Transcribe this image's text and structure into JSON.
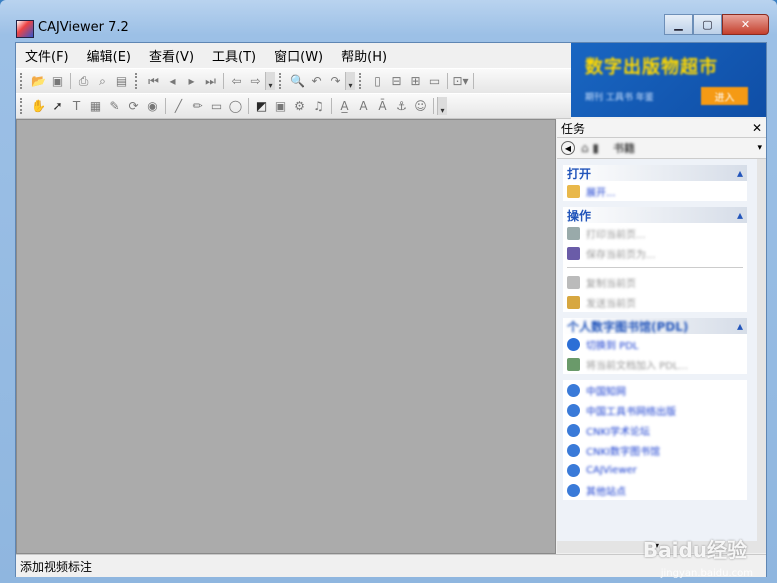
{
  "window": {
    "title": "CAJViewer 7.2",
    "minimize_glyph": "▁",
    "maximize_glyph": "▢",
    "close_glyph": "✕"
  },
  "menu": {
    "items": [
      "文件(F)",
      "编辑(E)",
      "查看(V)",
      "工具(T)",
      "窗口(W)",
      "帮助(H)"
    ]
  },
  "toolbar1": {
    "icons": [
      "open-folder-icon",
      "save-icon",
      "print-icon",
      "print-preview-icon",
      "clipboard-icon",
      "first-page-icon",
      "prev-page-icon",
      "next-page-icon",
      "last-page-icon",
      "back-arrow-icon",
      "forward-arrow-icon",
      "search-icon",
      "undo-icon",
      "redo-icon",
      "single-page-icon",
      "continuous-page-icon",
      "facing-page-icon",
      "columns-icon",
      "zoom-dropdown-icon"
    ]
  },
  "toolbar2": {
    "icons": [
      "hand-tool-icon",
      "select-arrow-icon",
      "text-select-icon",
      "image-select-icon",
      "ocr-icon",
      "rotate-icon",
      "snapshot-icon",
      "line-tool-icon",
      "pencil-tool-icon",
      "rectangle-tool-icon",
      "ellipse-tool-icon",
      "highlight-icon",
      "stamp-icon",
      "gear-icon",
      "music-note-icon",
      "underline-icon",
      "strike-text-icon",
      "text-style-icon",
      "anchor-icon",
      "user-note-icon"
    ]
  },
  "ad": {
    "title": "数字出版物超市",
    "subtitle": "期刊  工具书  年鉴",
    "button": "进入"
  },
  "taskpane": {
    "header": "任务",
    "close_glyph": "✕",
    "tools_label": "书籍",
    "sections": [
      {
        "title": "打开",
        "items": [
          "展开..."
        ]
      },
      {
        "title": "操作",
        "items": [
          "打印当前页...",
          "保存当前页为...",
          "复制当前页",
          "发送当前页"
        ]
      },
      {
        "title": "个人数字图书馆(PDL)",
        "items": [
          "切换到 PDL",
          "将当前文档加入 PDL..."
        ]
      },
      {
        "title": "",
        "items": [
          "中国知网",
          "中国工具书网络出版",
          "CNKI学术论坛",
          "CNKI数字图书馆",
          "CAJViewer",
          "其他站点"
        ]
      }
    ]
  },
  "status": {
    "text": "添加视频标注"
  },
  "watermark": {
    "logo": "Baidu经验",
    "url": "jingyan.baidu.com"
  },
  "colors": {
    "workspace": "#ababab",
    "ad_background": "#1966c2",
    "ad_title": "#ffd800",
    "link": "#1a3fd0"
  }
}
